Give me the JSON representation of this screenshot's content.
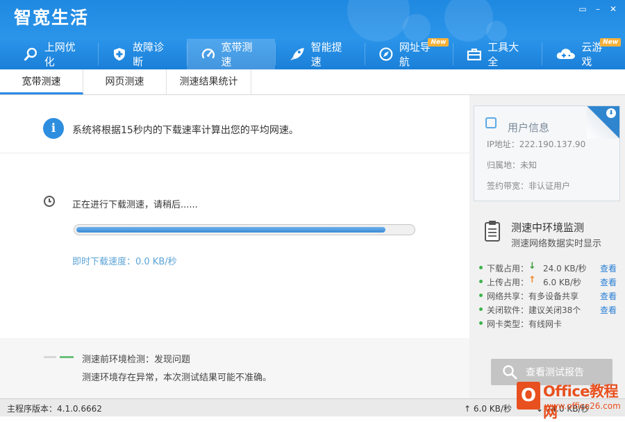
{
  "app": {
    "title": "智宽生活",
    "controls": [
      "▭",
      "–",
      "✕"
    ]
  },
  "nav": {
    "items": [
      {
        "label": "上网优化",
        "icon": "search-icon",
        "active": false,
        "badge": ""
      },
      {
        "label": "故障诊断",
        "icon": "shield-icon",
        "active": false,
        "badge": ""
      },
      {
        "label": "宽带测速",
        "icon": "speedometer-icon",
        "active": true,
        "badge": ""
      },
      {
        "label": "智能提速",
        "icon": "rocket-icon",
        "active": false,
        "badge": ""
      },
      {
        "label": "网址导航",
        "icon": "compass-icon",
        "active": false,
        "badge": "New"
      },
      {
        "label": "工具大全",
        "icon": "toolbox-icon",
        "active": false,
        "badge": ""
      },
      {
        "label": "云游戏",
        "icon": "cloud-gamepad-icon",
        "active": false,
        "badge": "New"
      }
    ]
  },
  "subtabs": [
    {
      "label": "宽带测速",
      "active": true
    },
    {
      "label": "网页测速",
      "active": false
    },
    {
      "label": "测速结果统计",
      "active": false
    }
  ],
  "main": {
    "info_text": "系统将根据15秒内的下载速率计算出您的平均网速。",
    "status_text": "正在进行下载测速，请稍后......",
    "progress": 0.92,
    "speed_text": "即时下载速度：0.0 KB/秒",
    "env_title": "测速前环境检测：发现问题",
    "env_desc": "测速环境存在异常，本次测试结果可能不准确。"
  },
  "user_info": {
    "title": "用户信息",
    "ip": "IP地址：222.190.137.90",
    "location": "归属地：未知",
    "bandwidth": "签约带宽：非认证用户"
  },
  "monitor": {
    "title": "测速中环境监测",
    "subtitle": "测速网络数据实时显示",
    "rows": [
      {
        "label": "下载占用：",
        "arrow": "↓",
        "arrow_color": "#3a9a3a",
        "value": "24.0 KB/秒",
        "link": "查看"
      },
      {
        "label": "上传占用：",
        "arrow": "↑",
        "arrow_color": "#f0892a",
        "value": "6.0 KB/秒",
        "link": "查看"
      },
      {
        "label": "网络共享：有多设备共享",
        "arrow": "",
        "arrow_color": "",
        "value": "",
        "link": "查看"
      },
      {
        "label": "关闭软件：建议关闭38个",
        "arrow": "",
        "arrow_color": "",
        "value": "",
        "link": "查看"
      },
      {
        "label": "网卡类型：有线网卡",
        "arrow": "",
        "arrow_color": "",
        "value": "",
        "link": ""
      }
    ],
    "report_button": "查看测试报告"
  },
  "statusbar": {
    "version": "主程序版本：4.1.0.6662",
    "upload": "↑ 6.0 KB/秒",
    "download": "↓ 24.0 KB/秒"
  },
  "watermark": {
    "logo": "O",
    "title": "Office教程网",
    "url": "www.office26.com"
  },
  "colors": {
    "header_blue": "#2b95ea",
    "accent_blue": "#2a8ae6",
    "link_blue": "#2a7fd4",
    "speed_text": "#5aa3d6",
    "ok_green": "#3db24b",
    "watermark_orange": "#e8501f"
  }
}
